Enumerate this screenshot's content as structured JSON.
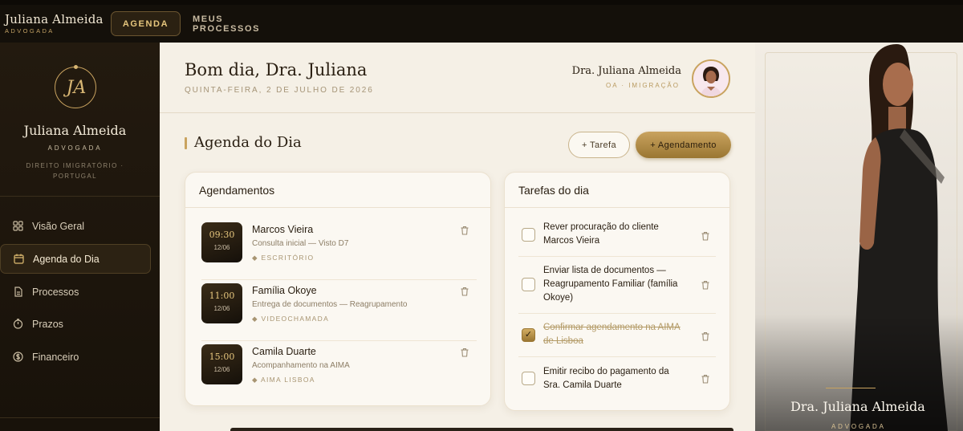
{
  "topbar": {
    "brand_name": "Juliana Almeida",
    "brand_sub": "ADVOGADA",
    "tabs": [
      {
        "label": "AGENDA",
        "active": true
      },
      {
        "label": "MEUS PROCESSOS",
        "active": false
      }
    ]
  },
  "sidebar": {
    "logo_text": "JA",
    "name": "Juliana Almeida",
    "role": "ADVOGADA",
    "area": "DIREITO IMIGRATÓRIO · PORTUGAL",
    "items": [
      {
        "label": "Visão Geral",
        "icon": "grid-icon",
        "active": false
      },
      {
        "label": "Agenda do Dia",
        "icon": "calendar-icon",
        "active": true
      },
      {
        "label": "Processos",
        "icon": "document-icon",
        "active": false
      },
      {
        "label": "Prazos",
        "icon": "clock-icon",
        "active": false
      },
      {
        "label": "Financeiro",
        "icon": "dollar-icon",
        "active": false
      }
    ]
  },
  "header": {
    "greeting": "Bom dia, Dra. Juliana",
    "date": "QUINTA-FEIRA, 2 DE JULHO DE 2026",
    "profile_name": "Dra. Juliana Almeida",
    "profile_sub": "OA · IMIGRAÇÃO"
  },
  "section": {
    "title": "Agenda do Dia",
    "btn_tarefa": "+ Tarefa",
    "btn_agendamento": "+ Agendamento"
  },
  "appointments": {
    "title": "Agendamentos",
    "items": [
      {
        "time": "09:30",
        "date": "12/06",
        "name": "Marcos Vieira",
        "desc": "Consulta inicial — Visto D7",
        "location": "◆ ESCRITÓRIO"
      },
      {
        "time": "11:00",
        "date": "12/06",
        "name": "Família Okoye",
        "desc": "Entrega de documentos — Reagrupamento",
        "location": "◆ VIDEOCHAMADA"
      },
      {
        "time": "15:00",
        "date": "12/06",
        "name": "Camila Duarte",
        "desc": "Acompanhamento na AIMA",
        "location": "◆ AIMA LISBOA"
      }
    ]
  },
  "tasks": {
    "title": "Tarefas do dia",
    "items": [
      {
        "text": "Rever procuração do cliente Marcos Vieira",
        "done": false
      },
      {
        "text": "Enviar lista de documentos — Reagrupamento Familiar (família Okoye)",
        "done": false
      },
      {
        "text": "Confirmar agendamento na AIMA de Lisboa",
        "done": true
      },
      {
        "text": "Emitir recibo do pagamento da Sra. Camila Duarte",
        "done": false
      }
    ]
  },
  "photo_panel": {
    "name": "Dra. Juliana Almeida",
    "role": "ADVOGADA"
  },
  "colors": {
    "gold": "#c9a35f",
    "dark": "#1a130b",
    "cream": "#f5f0e6"
  }
}
